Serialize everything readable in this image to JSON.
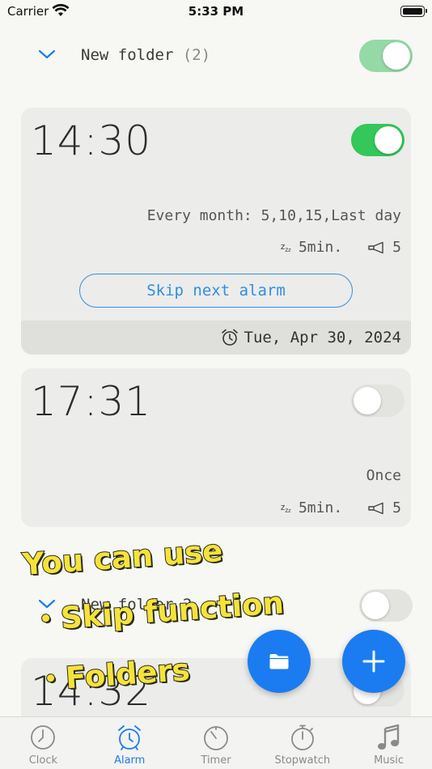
{
  "status_bar": {
    "carrier": "Carrier",
    "time": "5:33 PM"
  },
  "folder1": {
    "name": "New folder",
    "count": "(2)"
  },
  "alarms": [
    {
      "time": "14:30",
      "repeat": "Every month: 5,10,15,Last day",
      "snooze": "5min.",
      "volume": "5",
      "skip_label": "Skip next alarm",
      "next_date": "Tue, Apr 30, 2024"
    },
    {
      "time": "17:31",
      "repeat": "Once",
      "snooze": "5min.",
      "volume": "5"
    },
    {
      "time": "14:32"
    }
  ],
  "folder2": {
    "name": "New folder 2"
  },
  "promo": {
    "line1": "You can use",
    "line2": "・Skip function",
    "line3": "・Folders"
  },
  "tabs": [
    {
      "label": "Clock"
    },
    {
      "label": "Alarm"
    },
    {
      "label": "Timer"
    },
    {
      "label": "Stopwatch"
    },
    {
      "label": "Music"
    }
  ],
  "colors": {
    "accent": "#1a7cf0",
    "toggle_on": "#34c759",
    "background": "#f7f7f4",
    "card": "#ececea"
  }
}
